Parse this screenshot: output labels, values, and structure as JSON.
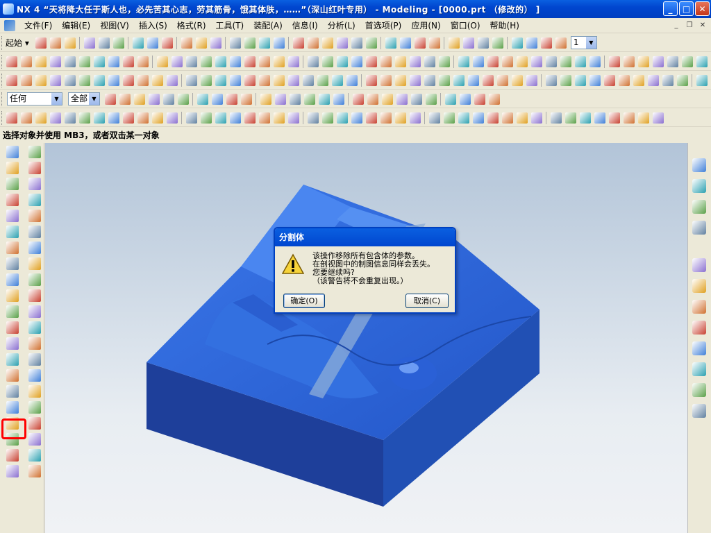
{
  "window": {
    "title": "NX 4 “天将降大任于斯人也，必先苦其心志，劳其筋骨，饿其体肤，……”（深山红叶专用） - Modeling - [0000.prt （修改的） ]",
    "controls": {
      "minimize": "_",
      "maximize": "□",
      "close": "✕"
    }
  },
  "menubar": {
    "items": [
      "文件(F)",
      "编辑(E)",
      "视图(V)",
      "插入(S)",
      "格式(R)",
      "工具(T)",
      "装配(A)",
      "信息(I)",
      "分析(L)",
      "首选项(P)",
      "应用(N)",
      "窗口(O)",
      "帮助(H)"
    ],
    "mdi_controls": {
      "minimize": "_",
      "restore": "❐",
      "close": "✕"
    }
  },
  "toolbar": {
    "start_label": "起始",
    "layer_value": "1",
    "filter_value": "任何",
    "scope_value": "全部"
  },
  "status_prompt": "选择对象并使用 MB3，或者双击某一对象",
  "dialog": {
    "title": "分割体",
    "message_lines": [
      "该操作移除所有包含体的参数。",
      "在剖视图中的制图信息同样会丢失。",
      "您要继续吗?",
      "（该警告将不会重复出现。）"
    ],
    "ok_label": "确定(O)",
    "cancel_label": "取消(C)"
  },
  "colors": {
    "title_bar": "#0054e3",
    "model_blue": "#2f6be0",
    "highlight": "#ff0000"
  }
}
